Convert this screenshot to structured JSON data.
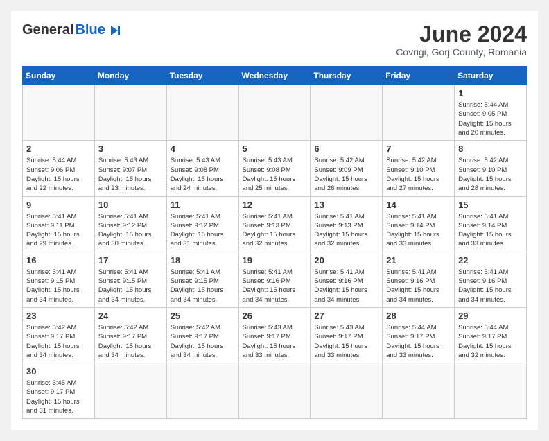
{
  "header": {
    "logo_general": "General",
    "logo_blue": "Blue",
    "month_title": "June 2024",
    "location": "Covrigi, Gorj County, Romania"
  },
  "weekdays": [
    "Sunday",
    "Monday",
    "Tuesday",
    "Wednesday",
    "Thursday",
    "Friday",
    "Saturday"
  ],
  "weeks": [
    [
      {
        "day": "",
        "info": ""
      },
      {
        "day": "",
        "info": ""
      },
      {
        "day": "",
        "info": ""
      },
      {
        "day": "",
        "info": ""
      },
      {
        "day": "",
        "info": ""
      },
      {
        "day": "",
        "info": ""
      },
      {
        "day": "1",
        "info": "Sunrise: 5:44 AM\nSunset: 9:05 PM\nDaylight: 15 hours and 20 minutes."
      }
    ],
    [
      {
        "day": "2",
        "info": "Sunrise: 5:44 AM\nSunset: 9:06 PM\nDaylight: 15 hours and 22 minutes."
      },
      {
        "day": "3",
        "info": "Sunrise: 5:43 AM\nSunset: 9:07 PM\nDaylight: 15 hours and 23 minutes."
      },
      {
        "day": "4",
        "info": "Sunrise: 5:43 AM\nSunset: 9:08 PM\nDaylight: 15 hours and 24 minutes."
      },
      {
        "day": "5",
        "info": "Sunrise: 5:43 AM\nSunset: 9:08 PM\nDaylight: 15 hours and 25 minutes."
      },
      {
        "day": "6",
        "info": "Sunrise: 5:42 AM\nSunset: 9:09 PM\nDaylight: 15 hours and 26 minutes."
      },
      {
        "day": "7",
        "info": "Sunrise: 5:42 AM\nSunset: 9:10 PM\nDaylight: 15 hours and 27 minutes."
      },
      {
        "day": "8",
        "info": "Sunrise: 5:42 AM\nSunset: 9:10 PM\nDaylight: 15 hours and 28 minutes."
      }
    ],
    [
      {
        "day": "9",
        "info": "Sunrise: 5:41 AM\nSunset: 9:11 PM\nDaylight: 15 hours and 29 minutes."
      },
      {
        "day": "10",
        "info": "Sunrise: 5:41 AM\nSunset: 9:12 PM\nDaylight: 15 hours and 30 minutes."
      },
      {
        "day": "11",
        "info": "Sunrise: 5:41 AM\nSunset: 9:12 PM\nDaylight: 15 hours and 31 minutes."
      },
      {
        "day": "12",
        "info": "Sunrise: 5:41 AM\nSunset: 9:13 PM\nDaylight: 15 hours and 32 minutes."
      },
      {
        "day": "13",
        "info": "Sunrise: 5:41 AM\nSunset: 9:13 PM\nDaylight: 15 hours and 32 minutes."
      },
      {
        "day": "14",
        "info": "Sunrise: 5:41 AM\nSunset: 9:14 PM\nDaylight: 15 hours and 33 minutes."
      },
      {
        "day": "15",
        "info": "Sunrise: 5:41 AM\nSunset: 9:14 PM\nDaylight: 15 hours and 33 minutes."
      }
    ],
    [
      {
        "day": "16",
        "info": "Sunrise: 5:41 AM\nSunset: 9:15 PM\nDaylight: 15 hours and 34 minutes."
      },
      {
        "day": "17",
        "info": "Sunrise: 5:41 AM\nSunset: 9:15 PM\nDaylight: 15 hours and 34 minutes."
      },
      {
        "day": "18",
        "info": "Sunrise: 5:41 AM\nSunset: 9:15 PM\nDaylight: 15 hours and 34 minutes."
      },
      {
        "day": "19",
        "info": "Sunrise: 5:41 AM\nSunset: 9:16 PM\nDaylight: 15 hours and 34 minutes."
      },
      {
        "day": "20",
        "info": "Sunrise: 5:41 AM\nSunset: 9:16 PM\nDaylight: 15 hours and 34 minutes."
      },
      {
        "day": "21",
        "info": "Sunrise: 5:41 AM\nSunset: 9:16 PM\nDaylight: 15 hours and 34 minutes."
      },
      {
        "day": "22",
        "info": "Sunrise: 5:41 AM\nSunset: 9:16 PM\nDaylight: 15 hours and 34 minutes."
      }
    ],
    [
      {
        "day": "23",
        "info": "Sunrise: 5:42 AM\nSunset: 9:17 PM\nDaylight: 15 hours and 34 minutes."
      },
      {
        "day": "24",
        "info": "Sunrise: 5:42 AM\nSunset: 9:17 PM\nDaylight: 15 hours and 34 minutes."
      },
      {
        "day": "25",
        "info": "Sunrise: 5:42 AM\nSunset: 9:17 PM\nDaylight: 15 hours and 34 minutes."
      },
      {
        "day": "26",
        "info": "Sunrise: 5:43 AM\nSunset: 9:17 PM\nDaylight: 15 hours and 33 minutes."
      },
      {
        "day": "27",
        "info": "Sunrise: 5:43 AM\nSunset: 9:17 PM\nDaylight: 15 hours and 33 minutes."
      },
      {
        "day": "28",
        "info": "Sunrise: 5:44 AM\nSunset: 9:17 PM\nDaylight: 15 hours and 33 minutes."
      },
      {
        "day": "29",
        "info": "Sunrise: 5:44 AM\nSunset: 9:17 PM\nDaylight: 15 hours and 32 minutes."
      }
    ],
    [
      {
        "day": "30",
        "info": "Sunrise: 5:45 AM\nSunset: 9:17 PM\nDaylight: 15 hours and 31 minutes."
      },
      {
        "day": "",
        "info": ""
      },
      {
        "day": "",
        "info": ""
      },
      {
        "day": "",
        "info": ""
      },
      {
        "day": "",
        "info": ""
      },
      {
        "day": "",
        "info": ""
      },
      {
        "day": "",
        "info": ""
      }
    ]
  ]
}
